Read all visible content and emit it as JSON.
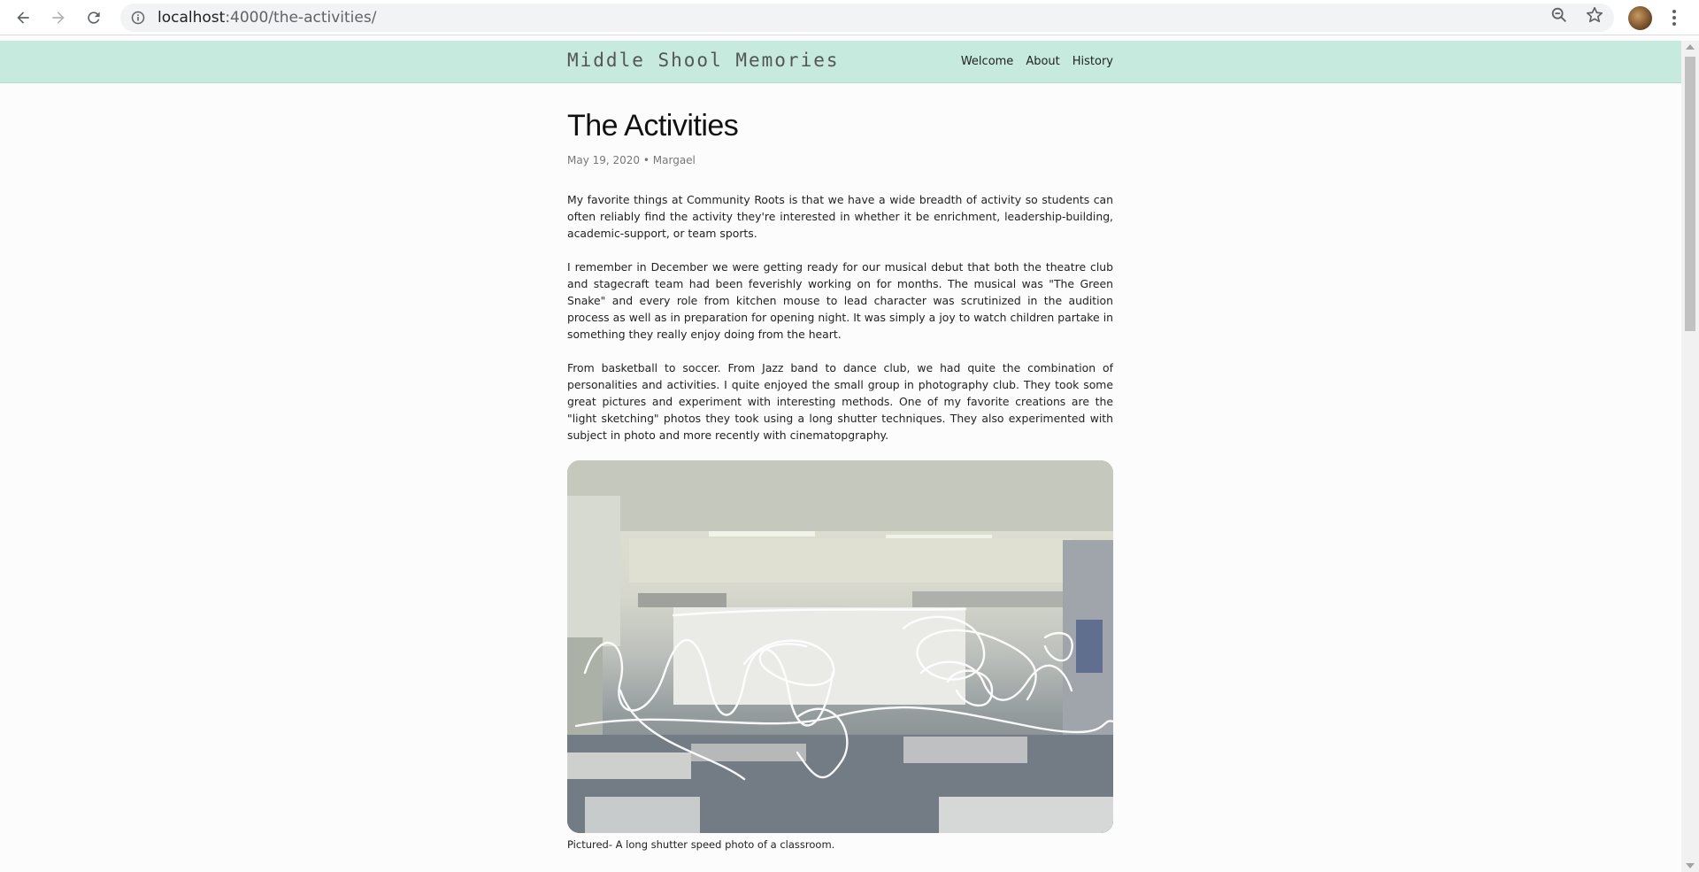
{
  "browser": {
    "url_host": "localhost",
    "url_rest": ":4000/the-activities/",
    "icons": [
      "back-icon",
      "forward-icon",
      "reload-icon",
      "info-icon",
      "zoom-icon",
      "star-icon",
      "avatar",
      "menu-kebab-icon"
    ]
  },
  "site": {
    "title": "Middle Shool Memories",
    "nav": [
      {
        "label": "Welcome"
      },
      {
        "label": "About"
      },
      {
        "label": "History"
      }
    ],
    "header_color": "#c6eade"
  },
  "post": {
    "title": "The Activities",
    "meta": "May 19, 2020 • Margael",
    "paragraphs": [
      "My favorite things at Community Roots is that we have a wide breadth of activity so students can often reliably find the activity they're interested in whether it be enrichment, leadership-building, academic-support, or team sports.",
      "I remember in December we were getting ready for our musical debut that both the theatre club and stagecraft team had been feverishly working on for months. The musical was \"The Green Snake\" and every role from kitchen mouse to lead character was scrutinized in the audition process as well as in preparation for opening night. It was simply a joy to watch children partake in something they really enjoy doing from the heart.",
      "From basketball to soccer. From Jazz band to dance club, we had quite the combination of personalities and activities. I quite enjoyed the small group in photography club. They took some great pictures and experiment with interesting methods. One of my favorite creations are the \"light sketching\" photos they took using a long shutter techniques. They also experimented with subject in photo and more recently with cinematopgraphy."
    ],
    "caption": "Pictured- A long shutter speed photo of a classroom."
  }
}
